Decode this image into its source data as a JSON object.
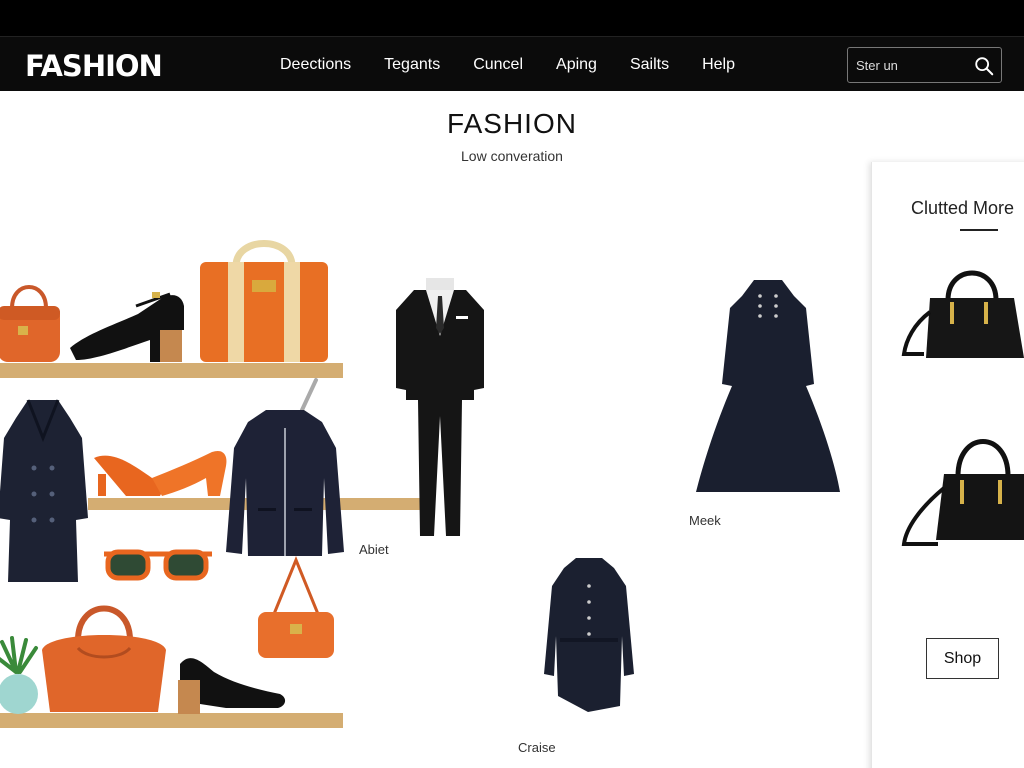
{
  "header": {
    "logo": "FASHION",
    "nav": [
      "Deections",
      "Tegants",
      "Cuncel",
      "Aping",
      "Sailts",
      "Help"
    ],
    "search_placeholder": "Ster un"
  },
  "hero": {
    "title": "FASHION",
    "subtitle": "Low converation"
  },
  "products": {
    "suit_caption": "Abiet",
    "dress_caption": "Meek",
    "coat_dress_caption": "Craise"
  },
  "side_panel": {
    "title": "Clutted More",
    "shop_label": "Shop"
  },
  "colors": {
    "header_bg": "#0b0b0b",
    "accent_orange": "#e0662a",
    "navy": "#1d2233",
    "shelf": "#d4ad72"
  }
}
